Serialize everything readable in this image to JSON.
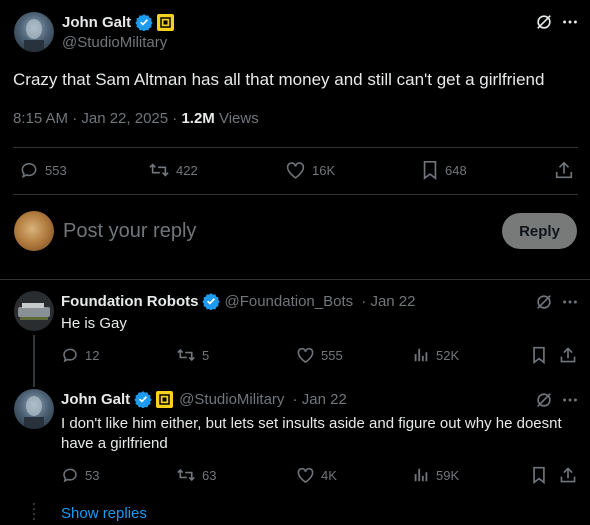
{
  "main_tweet": {
    "author_name": "John Galt",
    "author_handle": "@StudioMilitary",
    "text": "Crazy that Sam Altman has all that money and still can't get a girlfriend",
    "time": "8:15 AM · Jan 22, 2025 · ",
    "views_count": "1.2M",
    "views_label": " Views",
    "replies": "553",
    "retweets": "422",
    "likes": "16K",
    "bookmarks": "648"
  },
  "reply_box": {
    "placeholder": "Post your reply",
    "button": "Reply"
  },
  "replies": [
    {
      "author_name": "Foundation Robots",
      "author_handle": "@Foundation_Bots",
      "date": " · Jan 22",
      "text": "He is Gay",
      "replies": "12",
      "retweets": "5",
      "likes": "555",
      "views": "52K"
    },
    {
      "author_name": "John Galt",
      "author_handle": "@StudioMilitary",
      "date": " · Jan 22",
      "text": "I don't like him either, but lets set insults aside and figure out why he doesnt have a girlfriend",
      "replies": "53",
      "retweets": "63",
      "likes": "4K",
      "views": "59K"
    }
  ],
  "show_replies": "Show replies",
  "colors": {
    "accent": "#1d9bf0",
    "gold_badge": "#f4d21f",
    "muted": "#71767b",
    "divider": "#2f3336"
  }
}
